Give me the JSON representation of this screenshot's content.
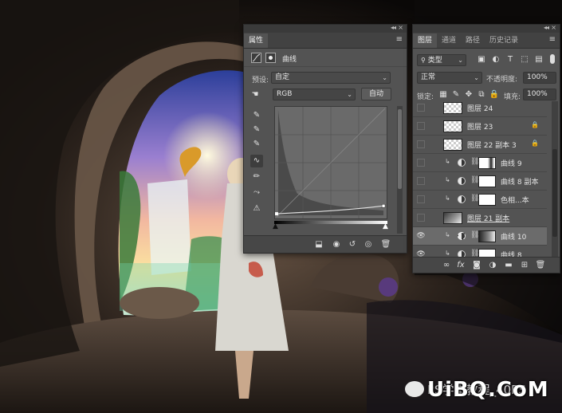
{
  "properties_panel": {
    "tab": "属性",
    "type_label": "曲线",
    "preset_label": "预设:",
    "preset_value": "自定",
    "channel_value": "RGB",
    "auto_button": "自动"
  },
  "layers_panel": {
    "tabs": [
      "图层",
      "通道",
      "路径",
      "历史记录"
    ],
    "filter_kind": "类型",
    "blend_mode": "正常",
    "opacity_label": "不透明度:",
    "opacity_value": "100%",
    "lock_label": "锁定:",
    "fill_label": "填充:",
    "fill_value": "100%",
    "layers": [
      {
        "name": "图层 24",
        "visible": false,
        "kind": "pixel",
        "locked": false
      },
      {
        "name": "图层 23",
        "visible": false,
        "kind": "pixel",
        "locked": true
      },
      {
        "name": "图层 22 副本 3",
        "visible": false,
        "kind": "pixel",
        "locked": true
      },
      {
        "name": "曲线 9",
        "visible": false,
        "kind": "curves",
        "locked": false
      },
      {
        "name": "曲线 8 副本",
        "visible": false,
        "kind": "curves",
        "locked": false
      },
      {
        "name": "色相...本",
        "visible": false,
        "kind": "hue",
        "locked": false
      },
      {
        "name": "图层 21 副本",
        "visible": false,
        "kind": "smart",
        "locked": false
      },
      {
        "name": "曲线 10",
        "visible": true,
        "kind": "curves",
        "locked": false,
        "selected": true
      },
      {
        "name": "曲线 8",
        "visible": true,
        "kind": "curves",
        "locked": false
      }
    ]
  },
  "watermark": {
    "text": "UiBQ.CoM",
    "behind_text": "PS学堂教程_40PS"
  },
  "colors": {
    "panel_bg": "#535353",
    "panel_dark": "#424242",
    "selected_row": "#6b6b6b"
  },
  "icons": [
    "eye-icon",
    "lock-icon",
    "link-icon",
    "fx-icon",
    "mask-icon",
    "adjustment-icon",
    "folder-icon",
    "new-layer-icon",
    "trash-icon",
    "eyedropper-icon",
    "pencil-icon",
    "curve-icon",
    "clip-icon",
    "reset-icon",
    "visibility-icon"
  ]
}
